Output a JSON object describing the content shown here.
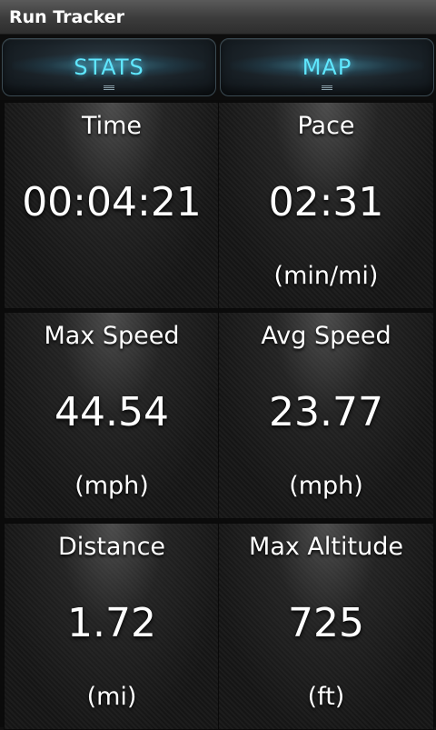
{
  "app": {
    "title": "Run Tracker"
  },
  "tabs": [
    {
      "label": "STATS"
    },
    {
      "label": "MAP"
    }
  ],
  "stats": [
    {
      "label": "Time",
      "value": "00:04:21",
      "unit": ""
    },
    {
      "label": "Pace",
      "value": "02:31",
      "unit": "(min/mi)"
    },
    {
      "label": "Max Speed",
      "value": "44.54",
      "unit": "(mph)"
    },
    {
      "label": "Avg Speed",
      "value": "23.77",
      "unit": "(mph)"
    },
    {
      "label": "Distance",
      "value": "1.72",
      "unit": "(mi)"
    },
    {
      "label": "Max Altitude",
      "value": "725",
      "unit": "(ft)"
    }
  ],
  "colors": {
    "tab_accent": "#5fe7ff",
    "text": "#ffffff",
    "titlebar": "#3b3b3b"
  }
}
